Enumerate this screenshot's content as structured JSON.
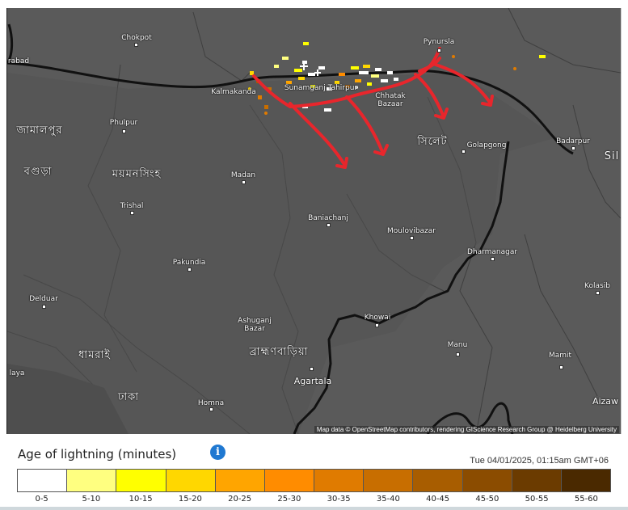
{
  "legend": {
    "title": "Age of lightning (minutes)",
    "timestamp": "Tue 04/01/2025, 01:15am GMT+06",
    "bins": [
      {
        "label": "0-5",
        "color": "#ffffff"
      },
      {
        "label": "5-10",
        "color": "#ffff80"
      },
      {
        "label": "10-15",
        "color": "#ffff00"
      },
      {
        "label": "15-20",
        "color": "#ffd700"
      },
      {
        "label": "20-25",
        "color": "#ffa500"
      },
      {
        "label": "25-30",
        "color": "#ff8c00"
      },
      {
        "label": "30-35",
        "color": "#e07b00"
      },
      {
        "label": "35-40",
        "color": "#c86e00"
      },
      {
        "label": "40-45",
        "color": "#a85d00"
      },
      {
        "label": "45-50",
        "color": "#8b4c00"
      },
      {
        "label": "50-55",
        "color": "#6b3b00"
      },
      {
        "label": "55-60",
        "color": "#4a2900"
      }
    ]
  },
  "map": {
    "attribution": "Map data © OpenStreetMap contributors, rendering GIScience Research Group @ Heidelberg University",
    "places": [
      {
        "name": "Chokpot"
      },
      {
        "name": "rabad"
      },
      {
        "name": "Kalmakanda"
      },
      {
        "name": "Sunamganj Tahirpur"
      },
      {
        "name": "Chhatak Bazaar"
      },
      {
        "name": "Pynursla"
      },
      {
        "name": "Phulpur"
      },
      {
        "name": "জামালপুর"
      },
      {
        "name": "বগুড়া"
      },
      {
        "name": "ময়মনসিংহ"
      },
      {
        "name": "সিলেট"
      },
      {
        "name": "Golapgong"
      },
      {
        "name": "Badarpur"
      },
      {
        "name": "Sil"
      },
      {
        "name": "Madan"
      },
      {
        "name": "Trishal"
      },
      {
        "name": "Baniachanj"
      },
      {
        "name": "Moulovibazar"
      },
      {
        "name": "Dharmanagar"
      },
      {
        "name": "Pakundia"
      },
      {
        "name": "Kolasib"
      },
      {
        "name": "Delduar"
      },
      {
        "name": "Ashuganj Bazar"
      },
      {
        "name": "Khowai"
      },
      {
        "name": "ধামরাই"
      },
      {
        "name": "ব্রাহ্মণবাড়িয়া"
      },
      {
        "name": "Manu"
      },
      {
        "name": "Mamit"
      },
      {
        "name": "laya"
      },
      {
        "name": "Agartala"
      },
      {
        "name": "ঢাকা"
      },
      {
        "name": "Homna"
      },
      {
        "name": "Aizaw"
      }
    ]
  }
}
